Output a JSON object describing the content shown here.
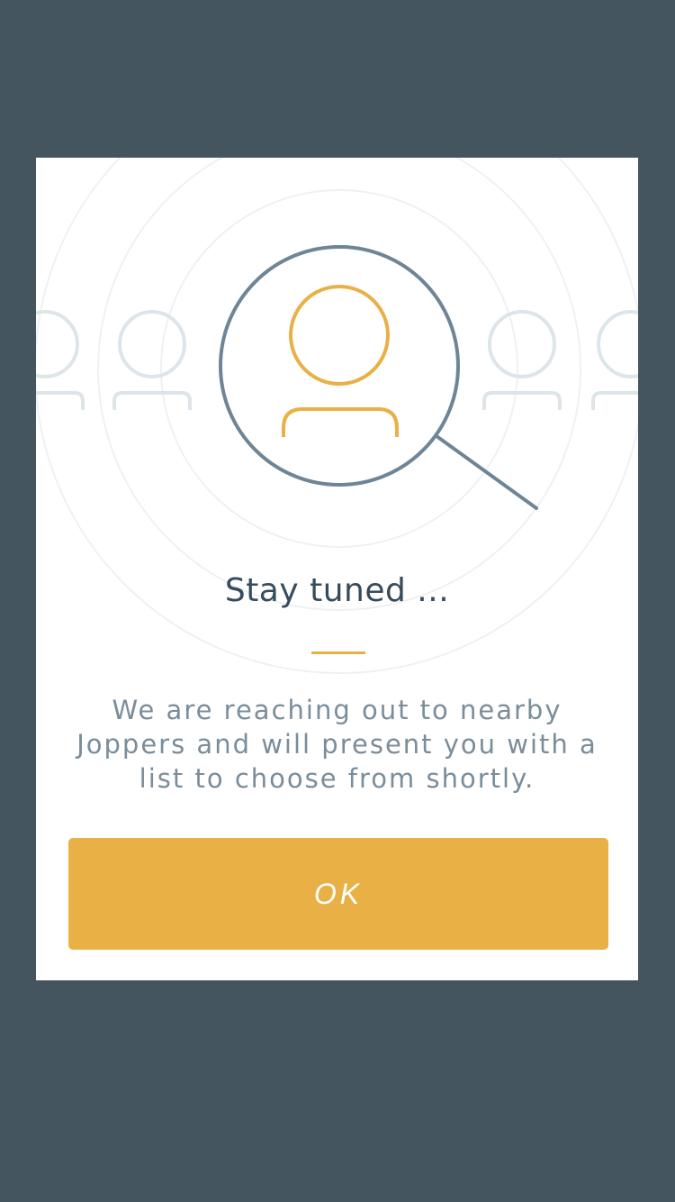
{
  "dialog": {
    "title": "Stay tuned ...",
    "message": "We are reaching out to nearby Joppers and will present you with a list to choose from shortly.",
    "ok_label": "OK",
    "illustration_icon": "magnifier-person-search-icon"
  },
  "colors": {
    "background": "#45555f",
    "card": "#ffffff",
    "accent": "#e9b046",
    "magnifier": "#6e8597",
    "faded_people": "#dde5e9",
    "title_text": "#364b5c",
    "body_text": "#7a8d9b"
  }
}
